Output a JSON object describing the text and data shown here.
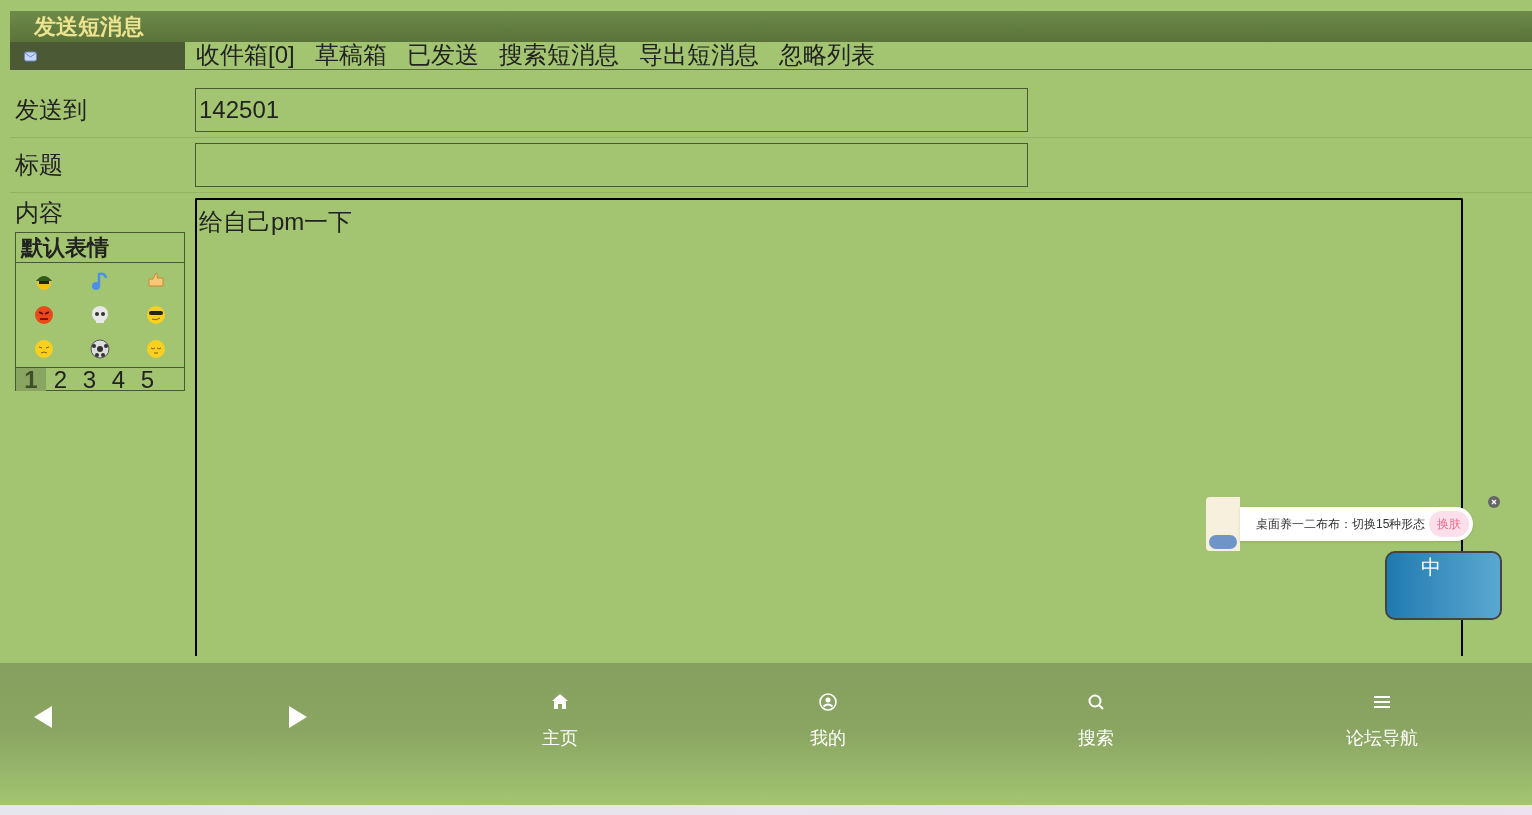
{
  "header": {
    "title": "发送短消息"
  },
  "tabs": [
    {
      "label": "收件箱[0]"
    },
    {
      "label": "草稿箱"
    },
    {
      "label": "已发送"
    },
    {
      "label": "搜索短消息"
    },
    {
      "label": "导出短消息"
    },
    {
      "label": "忽略列表"
    }
  ],
  "form": {
    "fields": [
      {
        "label": "发送到",
        "value": "142501"
      },
      {
        "label": "标题"
      }
    ],
    "content": {
      "label": "内容",
      "value": "给自己pm一下"
    }
  },
  "emoticons": {
    "title": "默认表情",
    "pages": [
      {
        "label": "1",
        "selected": true
      },
      {
        "label": "2",
        "selected": false
      },
      {
        "label": "3",
        "selected": false
      },
      {
        "label": "4",
        "selected": false
      },
      {
        "label": "5",
        "selected": false
      }
    ]
  },
  "widget": {
    "text": "桌面养一二布布：切换15种形态",
    "button": "换肤",
    "badge": "中"
  },
  "bottom_nav": [
    {
      "label": "主页",
      "kind": "home"
    },
    {
      "label": "我的",
      "kind": "user"
    },
    {
      "label": "搜索",
      "kind": "search"
    },
    {
      "label": "论坛导航",
      "kind": "menu"
    }
  ]
}
